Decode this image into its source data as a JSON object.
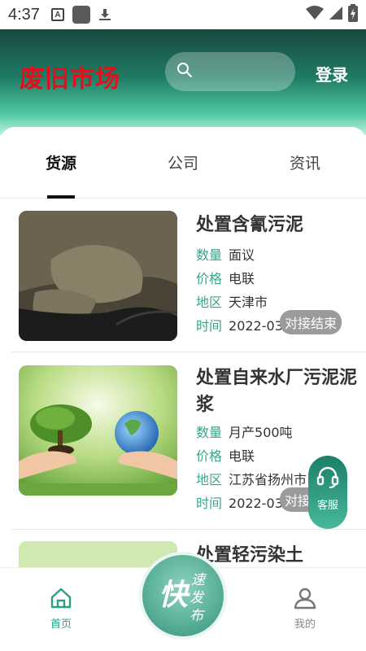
{
  "status_bar": {
    "time": "4:37",
    "a_icon_letter": "A"
  },
  "header": {
    "title": "废旧市场",
    "login_label": "登录"
  },
  "tabs": [
    {
      "label": "货源"
    },
    {
      "label": "公司"
    },
    {
      "label": "资讯"
    }
  ],
  "items": [
    {
      "title": "处置含氰污泥",
      "fields": [
        {
          "key": "数量",
          "value": "面议"
        },
        {
          "key": "价格",
          "value": "电联"
        },
        {
          "key": "地区",
          "value": "天津市"
        },
        {
          "key": "时间",
          "value": "2022-03"
        }
      ],
      "tag": "对接结束"
    },
    {
      "title": "处置自来水厂污泥泥浆",
      "fields": [
        {
          "key": "数量",
          "value": "月产500吨"
        },
        {
          "key": "价格",
          "value": "电联"
        },
        {
          "key": "地区",
          "value": "江苏省扬州市"
        },
        {
          "key": "时间",
          "value": "2022-03"
        }
      ],
      "tag": "对接结束"
    },
    {
      "title": "处置轻污染土"
    }
  ],
  "service": {
    "label": "客服"
  },
  "bottom_nav": {
    "home_label": "首页",
    "mine_label": "我的",
    "publish_big": "快",
    "publish_chars": [
      "速",
      "发",
      "布"
    ]
  },
  "colors": {
    "accent": "#2a9f83",
    "title_red": "#e0111c",
    "tag_gray": "#9b9b9b"
  }
}
